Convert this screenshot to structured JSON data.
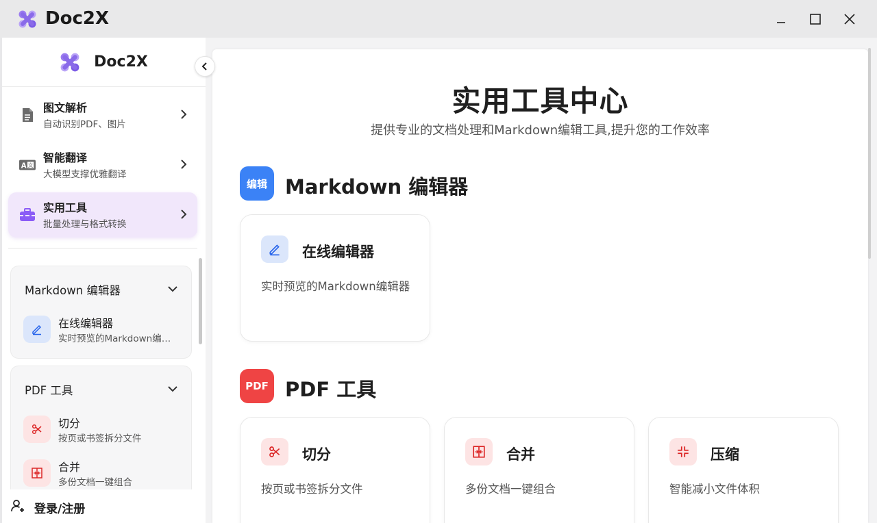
{
  "window": {
    "app_name": "Doc2X",
    "controls": [
      "minimize",
      "maximize",
      "close"
    ]
  },
  "sidebar": {
    "brand": "Doc2X",
    "nav": [
      {
        "title": "图文解析",
        "subtitle": "自动识别PDF、图片",
        "icon": "document-icon",
        "active": false
      },
      {
        "title": "智能翻译",
        "subtitle": "大模型支撑优雅翻译",
        "icon": "translate-icon",
        "active": false
      },
      {
        "title": "实用工具",
        "subtitle": "批量处理与格式转换",
        "icon": "toolbox-icon",
        "active": true
      }
    ],
    "groups": [
      {
        "title": "Markdown 编辑器",
        "items": [
          {
            "title": "在线编辑器",
            "subtitle": "实时预览的Markdown编辑器",
            "icon": "edit-icon"
          }
        ]
      },
      {
        "title": "PDF 工具",
        "items": [
          {
            "title": "切分",
            "subtitle": "按页或书签拆分文件",
            "icon": "scissors-icon"
          },
          {
            "title": "合并",
            "subtitle": "多份文档一键组合",
            "icon": "merge-icon"
          }
        ]
      }
    ],
    "login_label": "登录/注册"
  },
  "main": {
    "title": "实用工具中心",
    "subtitle": "提供专业的文档处理和Markdown编辑工具,提升您的工作效率",
    "sections": [
      {
        "badge": "编辑",
        "badge_color": "#3b82f6",
        "title": "Markdown 编辑器",
        "cards": [
          {
            "title": "在线编辑器",
            "desc": "实时预览的Markdown编辑器",
            "icon": "edit-icon"
          }
        ]
      },
      {
        "badge": "PDF",
        "badge_color": "#ef4444",
        "title": "PDF 工具",
        "cards": [
          {
            "title": "切分",
            "desc": "按页或书签拆分文件",
            "icon": "scissors-icon"
          },
          {
            "title": "合并",
            "desc": "多份文档一键组合",
            "icon": "merge-icon"
          },
          {
            "title": "压缩",
            "desc": "智能减小文件体积",
            "icon": "compress-icon"
          }
        ]
      }
    ]
  },
  "colors": {
    "accent_purple": "#8b5cf6",
    "active_bg": "#f1e7fb",
    "blue": "#3b82f6",
    "red": "#ef4444"
  }
}
